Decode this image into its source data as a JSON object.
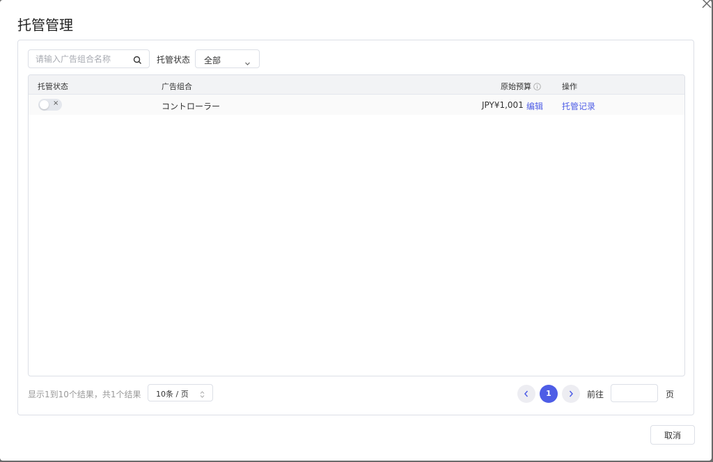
{
  "modal": {
    "title": "托管管理",
    "cancel_label": "取消"
  },
  "filters": {
    "search_placeholder": "请输入广告组合名称",
    "status_label": "托管状态",
    "status_value": "全部"
  },
  "table": {
    "headers": {
      "status": "托管状态",
      "group": "广告组合",
      "budget": "原始预算",
      "action": "操作"
    },
    "rows": [
      {
        "toggle_mark": "×",
        "toggle_on": false,
        "group": "コントローラー",
        "budget": "JPY¥1,001",
        "edit_label": "编辑",
        "history_label": "托管记录"
      }
    ]
  },
  "pagination": {
    "summary": "显示1到10个结果，共1个结果",
    "page_size": "10条 / 页",
    "current_page": "1",
    "goto_label": "前往",
    "goto_value": "",
    "page_suffix": "页"
  },
  "colors": {
    "accent": "#4e5de6",
    "header_bg": "#f2f3f5",
    "border": "#dcdfe6"
  }
}
